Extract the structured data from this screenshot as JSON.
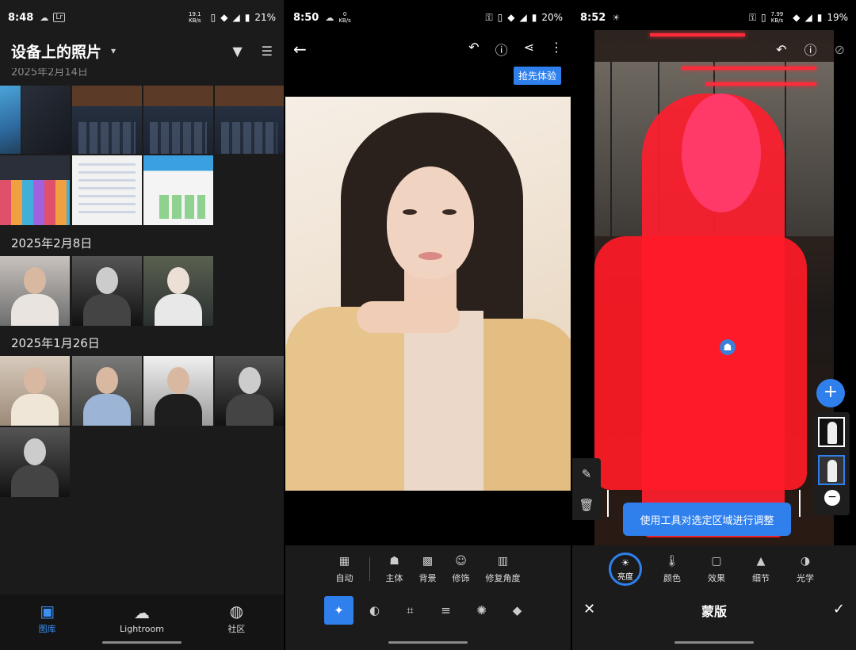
{
  "screen1": {
    "status": {
      "time": "8:48",
      "app_badge": "Lr",
      "battery": "21%",
      "speed_top": "19.1",
      "speed_bottom": "KB/s"
    },
    "header": {
      "title": "设备上的照片",
      "chevron_icon": "chevron-down-icon",
      "filter_icon": "filter-icon",
      "sort_icon": "sort-icon"
    },
    "date_groups": [
      {
        "label": "2025年2月14日"
      },
      {
        "label": "2025年2月8日"
      },
      {
        "label": "2025年1月26日"
      }
    ],
    "nav": [
      {
        "label": "图库",
        "icon": "library-icon",
        "active": true
      },
      {
        "label": "Lightroom",
        "icon": "lightroom-cloud-icon",
        "active": false
      },
      {
        "label": "社区",
        "icon": "globe-icon",
        "active": false
      }
    ],
    "accent": "#3b8ff0"
  },
  "screen2": {
    "status": {
      "time": "8:50",
      "battery": "20%",
      "speed_top": "0",
      "speed_bottom": "KB/s"
    },
    "toolbar": {
      "back_icon": "arrow-left-icon",
      "undo_icon": "undo-icon",
      "help_icon": "help-icon",
      "share_icon": "share-icon",
      "more_icon": "more-vertical-icon"
    },
    "try_badge": "抢先体验",
    "tools": [
      {
        "label": "自动",
        "icon": "auto-icon"
      },
      {
        "label": "主体",
        "icon": "subject-icon"
      },
      {
        "label": "背景",
        "icon": "background-icon"
      },
      {
        "label": "修饰",
        "icon": "retouch-icon"
      },
      {
        "label": "修复角度",
        "icon": "perspective-icon"
      }
    ],
    "modes": [
      {
        "icon": "magic-wand-icon",
        "active": true
      },
      {
        "icon": "mask-icon",
        "active": false
      },
      {
        "icon": "crop-icon",
        "active": false
      },
      {
        "icon": "sliders-icon",
        "active": false
      },
      {
        "icon": "healing-icon",
        "active": false
      },
      {
        "icon": "eraser-icon",
        "active": false
      }
    ]
  },
  "screen3": {
    "status": {
      "time": "8:52",
      "battery": "19%",
      "speed_top": "7.99",
      "speed_bottom": "KB/s"
    },
    "toolbar": {
      "undo_icon": "undo-icon",
      "help_icon": "help-icon",
      "crop_icon": "crop-icon"
    },
    "toast": "使用工具对选定区域进行调整",
    "tools": [
      {
        "label": "亮度",
        "icon": "brightness-icon",
        "active": true
      },
      {
        "label": "颜色",
        "icon": "thermometer-icon",
        "active": false
      },
      {
        "label": "效果",
        "icon": "effects-icon",
        "active": false
      },
      {
        "label": "细节",
        "icon": "detail-icon",
        "active": false
      },
      {
        "label": "光学",
        "icon": "optics-icon",
        "active": false
      }
    ],
    "bottom": {
      "title": "蒙版",
      "close_icon": "close-icon",
      "confirm_icon": "check-icon"
    }
  }
}
